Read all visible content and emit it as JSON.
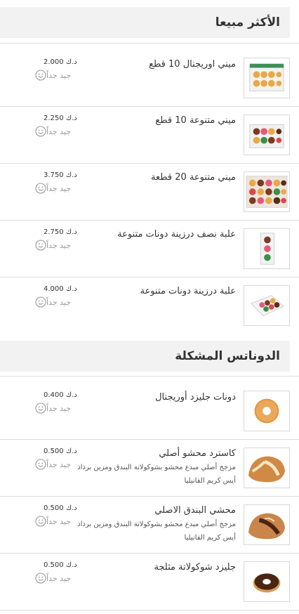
{
  "sections": [
    {
      "title": "الأكثر مبيعا",
      "items": [
        {
          "name": "ميني اوريجنال 10 قطع",
          "price": "2.000",
          "currency": "د.ك",
          "rating_label": "جيد جداً",
          "icon": "box-of-original-donuts"
        },
        {
          "name": "ميني متنوعة 10 قطع",
          "price": "2.250",
          "currency": "د.ك",
          "rating_label": "جيد جداً",
          "icon": "box-of-assorted-donuts"
        },
        {
          "name": "ميني متنوعة 20 قطعة",
          "price": "3.750",
          "currency": "د.ك",
          "rating_label": "جيد جداً",
          "icon": "tray-of-assorted-donuts"
        },
        {
          "name": "علبة نصف درزينة دونات متنوعة",
          "price": "2.750",
          "currency": "د.ك",
          "rating_label": "جيد جداً",
          "icon": "half-dozen-box"
        },
        {
          "name": "علبة درزينة دونات متنوعة",
          "price": "4.000",
          "currency": "د.ك",
          "rating_label": "جيد جداً",
          "icon": "dozen-box"
        }
      ]
    },
    {
      "title": "الدوناتس المشكلة",
      "items": [
        {
          "name": "دونات جليزد أوريجنال",
          "price": "0.400",
          "currency": "د.ك",
          "rating_label": "جيد جداً",
          "icon": "glazed-donut"
        },
        {
          "name": "كاسترد محشو أصلي",
          "description": "مزجج أصلي مبدع محشو بشوكولاتة البندق ومزين برذاذ أيس كريم الفانيليا",
          "price": "0.500",
          "currency": "د.ك",
          "rating_label": "جيد جداً",
          "icon": "custard-filled-donut"
        },
        {
          "name": "محشي البندق الاصلي",
          "description": "مزجج أصلي مبدع محشو بشوكولاتة البندق ومزين برذاذ أيس كريم الفانيليا",
          "price": "0.500",
          "currency": "د.ك",
          "rating_label": "جيد جداً",
          "icon": "hazelnut-filled-donut"
        },
        {
          "name": "جليزد شوكولاتة مثلجة",
          "price": "0.500",
          "currency": "د.ك",
          "rating_label": "جيد جداً",
          "icon": "chocolate-iced-donut"
        }
      ]
    }
  ]
}
